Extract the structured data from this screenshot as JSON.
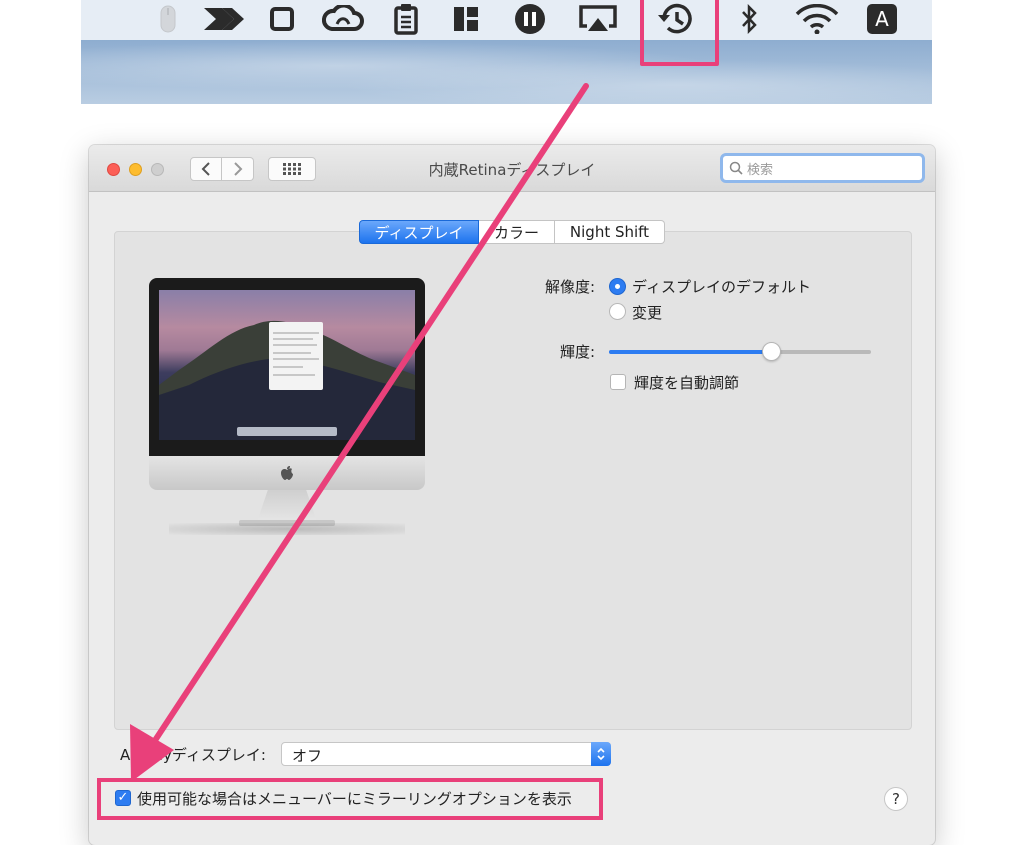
{
  "menubar": {
    "icons": [
      "mouse-icon",
      "chevron-arrow-icon",
      "square-icon",
      "creative-cloud-icon",
      "clipboard-icon",
      "grid-icon",
      "music-icon",
      "airplay-icon",
      "time-machine-icon",
      "bluetooth-icon",
      "wifi-icon",
      "input-source-icon"
    ],
    "input_source_label": "A"
  },
  "window": {
    "title": "内蔵Retinaディスプレイ",
    "search_placeholder": "検索"
  },
  "tabs": [
    {
      "label": "ディスプレイ",
      "selected": true
    },
    {
      "label": "カラー",
      "selected": false
    },
    {
      "label": "Night Shift",
      "selected": false
    }
  ],
  "resolution": {
    "label": "解像度:",
    "options": [
      {
        "label": "ディスプレイのデフォルト",
        "selected": true
      },
      {
        "label": "変更",
        "selected": false
      }
    ]
  },
  "brightness": {
    "label": "輝度:",
    "value": 0.62,
    "auto_label": "輝度を自動調節",
    "auto_checked": false
  },
  "airplay": {
    "label": "AirPlayディスプレイ:",
    "value": "オフ"
  },
  "mirror_option": {
    "label": "使用可能な場合はメニューバーにミラーリングオプションを表示",
    "checked": true
  },
  "help": "?",
  "colors": {
    "accent": "#2d7cf1",
    "annotation": "#e9407a"
  }
}
